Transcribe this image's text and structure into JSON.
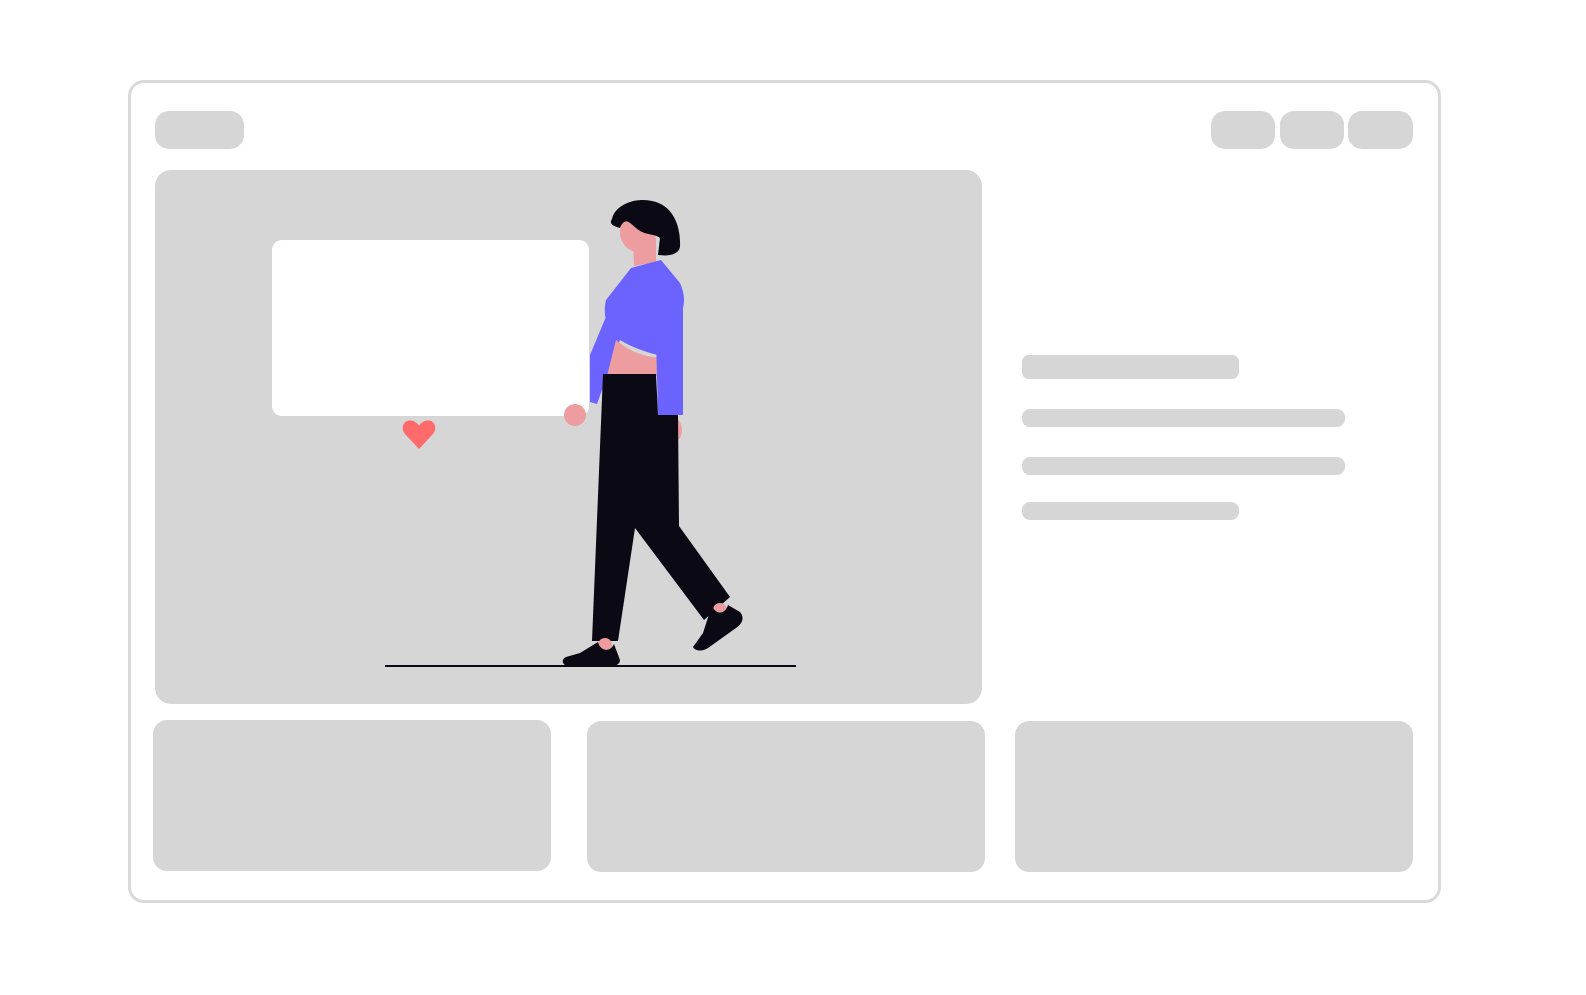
{
  "window": {
    "logo_placeholder": "",
    "nav_buttons": [
      "",
      "",
      ""
    ]
  },
  "hero": {
    "card_text": "",
    "icons": [
      "heart-icon"
    ]
  },
  "sidebar": {
    "lines": [
      "",
      "",
      "",
      ""
    ]
  },
  "bottom_cards": [
    "",
    "",
    ""
  ],
  "colors": {
    "placeholder": "#d6d6d6",
    "frame_border": "#d9d9d9",
    "accent": "#6c63ff",
    "heart": "#ff6b6b",
    "skin": "#ed9da0",
    "dark": "#0b0a14"
  }
}
